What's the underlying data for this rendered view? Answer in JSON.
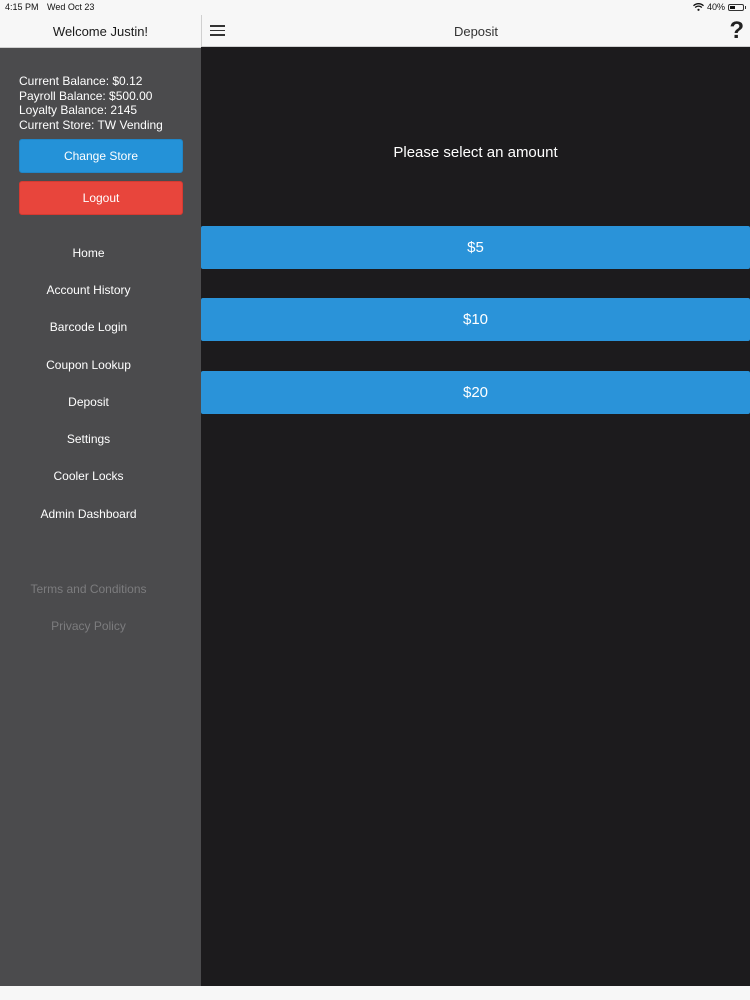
{
  "status_bar": {
    "time": "4:15 PM",
    "date": "Wed Oct 23",
    "battery": "40%",
    "battery_level": 0.4,
    "wifi_icon": "wifi-icon"
  },
  "sidebar": {
    "welcome": "Welcome Justin!",
    "balances": [
      "Current Balance: $0.12",
      "Payroll Balance: $500.00",
      "Loyalty Balance: 2145",
      "Current Store: TW Vending"
    ],
    "change_store_label": "Change Store",
    "logout_label": "Logout",
    "nav_items": [
      "Home",
      "Account History",
      "Barcode Login",
      "Coupon Lookup",
      "Deposit",
      "Settings",
      "Cooler Locks",
      "Admin Dashboard"
    ],
    "legal_items": [
      "Terms and Conditions",
      "Privacy Policy"
    ]
  },
  "header": {
    "title": "Deposit",
    "help_symbol": "?",
    "menu_icon": "hamburger-menu-icon"
  },
  "main": {
    "prompt": "Please select an amount",
    "amounts": [
      "$5",
      "$10",
      "$20"
    ]
  },
  "colors": {
    "primary_blue": "#2a93d9",
    "logout_red": "#e8453c",
    "sidebar_bg": "#4b4b4d",
    "main_bg": "#1c1b1d"
  }
}
